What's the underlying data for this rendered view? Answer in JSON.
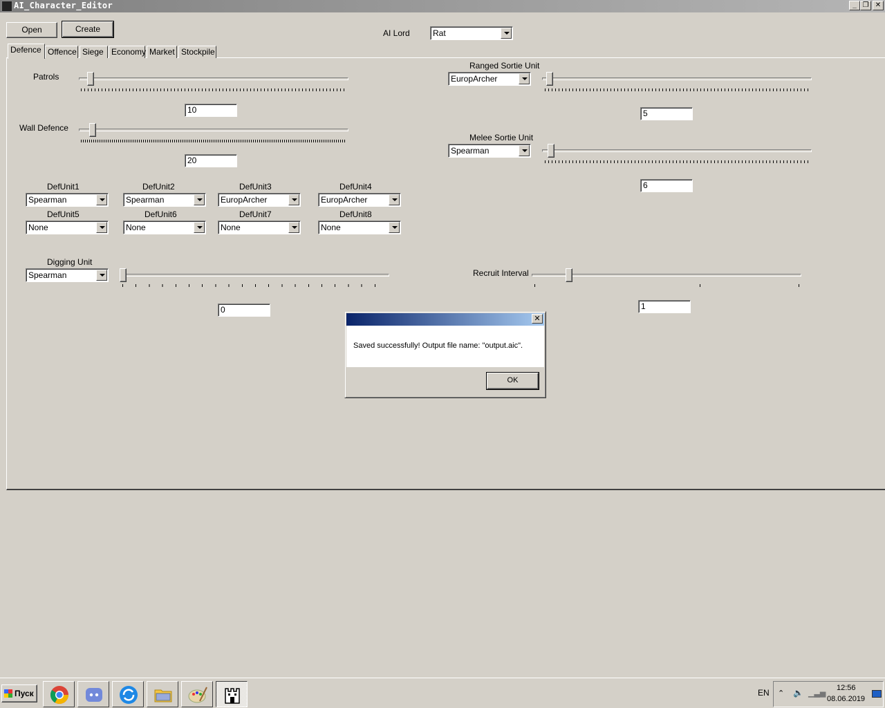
{
  "window": {
    "title": "AI_Character_Editor",
    "minimize_label": "_",
    "maximize_label": "❐",
    "close_label": "✕"
  },
  "toolbar": {
    "open_label": "Open",
    "create_label": "Create",
    "ai_lord_label": "AI Lord",
    "ai_lord_value": "Rat"
  },
  "tabs": [
    {
      "label": "Defence",
      "active": true
    },
    {
      "label": "Offence"
    },
    {
      "label": "Siege"
    },
    {
      "label": "Economy"
    },
    {
      "label": "Market"
    },
    {
      "label": "Stockpile"
    }
  ],
  "defence": {
    "patrols": {
      "label": "Patrols",
      "value": "10"
    },
    "wall_defence": {
      "label": "Wall Defence",
      "value": "20"
    },
    "def_units": [
      {
        "label": "DefUnit1",
        "value": "Spearman"
      },
      {
        "label": "DefUnit2",
        "value": "Spearman"
      },
      {
        "label": "DefUnit3",
        "value": "EuropArcher"
      },
      {
        "label": "DefUnit4",
        "value": "EuropArcher"
      },
      {
        "label": "DefUnit5",
        "value": "None"
      },
      {
        "label": "DefUnit6",
        "value": "None"
      },
      {
        "label": "DefUnit7",
        "value": "None"
      },
      {
        "label": "DefUnit8",
        "value": "None"
      }
    ],
    "digging_unit": {
      "label": "Digging Unit",
      "unit": "Spearman",
      "value": "0"
    },
    "ranged_sortie": {
      "label": "Ranged Sortie Unit",
      "unit": "EuropArcher",
      "value": "5"
    },
    "melee_sortie": {
      "label": "Melee Sortie Unit",
      "unit": "Spearman",
      "value": "6"
    },
    "recruit_interval": {
      "label": "Recruit Interval",
      "value": "1"
    }
  },
  "dialog": {
    "message": "Saved successfully! Output file name: \"output.aic\".",
    "ok_label": "OK",
    "close_label": "✕"
  },
  "taskbar": {
    "start_label": "Пуск",
    "apps": [
      {
        "icon": "chrome-icon"
      },
      {
        "icon": "discord-icon"
      },
      {
        "icon": "sync-icon"
      },
      {
        "icon": "folder-icon"
      },
      {
        "icon": "paint-icon"
      },
      {
        "icon": "castle-icon",
        "active": true
      }
    ],
    "language": "EN",
    "time": "12:56",
    "date": "08.06.2019"
  }
}
